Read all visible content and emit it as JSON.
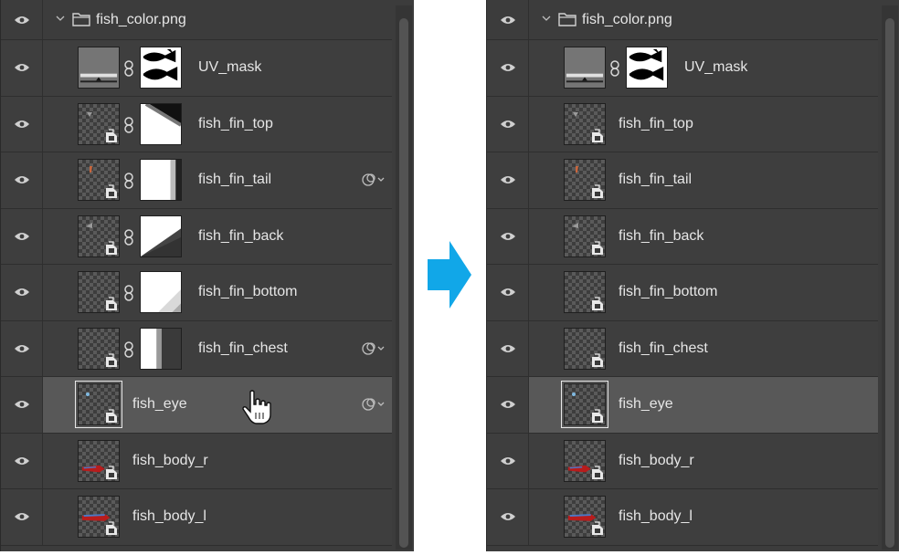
{
  "colors": {
    "panel_bg": "#3c3c3c",
    "row_bg": "#3e3e3e",
    "selected_bg": "#585858",
    "text": "#e6e6e6",
    "arrow": "#11a7e8"
  },
  "icons": {
    "visibility": "eye-icon",
    "expand": "chevron-down-icon",
    "group": "folder-icon",
    "link": "chain-link-icon",
    "smart_object": "smart-object-icon",
    "effects": "layer-effects-icon",
    "pointer": "hand-pointer-icon",
    "transition": "right-arrow-icon"
  },
  "before": {
    "group_name": "fish_color.png",
    "layers": [
      {
        "name": "UV_mask",
        "has_mask": true,
        "fx": false,
        "selected": false
      },
      {
        "name": "fish_fin_top",
        "has_mask": true,
        "fx": false,
        "selected": false
      },
      {
        "name": "fish_fin_tail",
        "has_mask": true,
        "fx": true,
        "selected": false
      },
      {
        "name": "fish_fin_back",
        "has_mask": true,
        "fx": false,
        "selected": false
      },
      {
        "name": "fish_fin_bottom",
        "has_mask": true,
        "fx": false,
        "selected": false
      },
      {
        "name": "fish_fin_chest",
        "has_mask": true,
        "fx": true,
        "selected": false
      },
      {
        "name": "fish_eye",
        "has_mask": false,
        "fx": true,
        "selected": true
      },
      {
        "name": "fish_body_r",
        "has_mask": false,
        "fx": false,
        "selected": false
      },
      {
        "name": "fish_body_l",
        "has_mask": false,
        "fx": false,
        "selected": false
      }
    ]
  },
  "after": {
    "group_name": "fish_color.png",
    "layers": [
      {
        "name": "UV_mask",
        "has_mask": true,
        "fx": false,
        "selected": false
      },
      {
        "name": "fish_fin_top",
        "has_mask": false,
        "fx": false,
        "selected": false
      },
      {
        "name": "fish_fin_tail",
        "has_mask": false,
        "fx": false,
        "selected": false
      },
      {
        "name": "fish_fin_back",
        "has_mask": false,
        "fx": false,
        "selected": false
      },
      {
        "name": "fish_fin_bottom",
        "has_mask": false,
        "fx": false,
        "selected": false
      },
      {
        "name": "fish_fin_chest",
        "has_mask": false,
        "fx": false,
        "selected": false
      },
      {
        "name": "fish_eye",
        "has_mask": false,
        "fx": false,
        "selected": true
      },
      {
        "name": "fish_body_r",
        "has_mask": false,
        "fx": false,
        "selected": false
      },
      {
        "name": "fish_body_l",
        "has_mask": false,
        "fx": false,
        "selected": false
      }
    ]
  }
}
